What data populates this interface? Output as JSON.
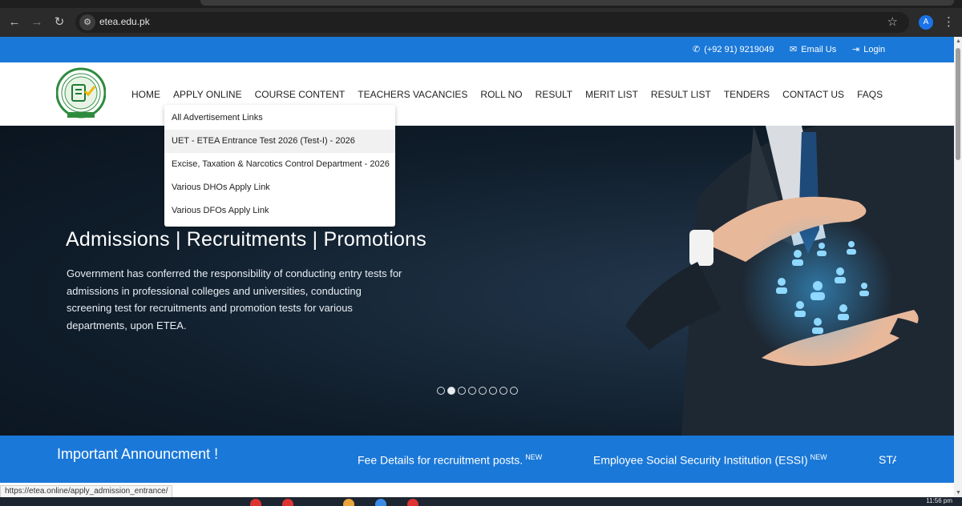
{
  "browser": {
    "url": "etea.edu.pk",
    "profile_initial": "A",
    "icons": {
      "back": "arrow-left-icon",
      "forward": "arrow-right-icon",
      "reload": "reload-icon",
      "site_info": "tune-icon",
      "bookmark": "star-icon",
      "menu": "kebab-icon"
    }
  },
  "topbar": {
    "phone": "(+92 91) 9219049",
    "email": "Email Us",
    "login": "Login"
  },
  "nav": {
    "items": [
      "HOME",
      "APPLY ONLINE",
      "COURSE CONTENT",
      "TEACHERS VACANCIES",
      "ROLL NO",
      "RESULT",
      "MERIT LIST",
      "RESULT LIST",
      "TENDERS",
      "CONTACT US",
      "FAQS"
    ]
  },
  "dropdown": {
    "items": [
      "All Advertisement Links",
      "UET - ETEA Entrance Test 2026 (Test-I) - 2026",
      "Excise, Taxation & Narcotics Control Department - 2026",
      "Various DHOs Apply Link",
      "Various DFOs Apply Link"
    ],
    "hovered_index": 1
  },
  "hero": {
    "title": "Admissions | Recruitments | Promotions",
    "text": "Government has conferred the responsibility of conducting entry tests for admissions in professional colleges and universities, conducting screening test for recruitments and promotion tests for various departments, upon ETEA.",
    "slide_count": 8,
    "active_slide": 2
  },
  "announcement": {
    "title": "Important Announcment !",
    "items": [
      {
        "text": "Fee Details for recruitment posts.",
        "badge": "NEW"
      },
      {
        "text": "Employee Social Security Institution (ESSI)",
        "badge": "NEW"
      },
      {
        "text": "STA",
        "badge": ""
      }
    ]
  },
  "status_bar": {
    "url": "https://etea.online/apply_admission_entrance/"
  },
  "taskbar": {
    "time": "11:56 pm"
  },
  "colors": {
    "brand_blue": "#1a78d8",
    "hero_dark": "#0f1c29"
  }
}
